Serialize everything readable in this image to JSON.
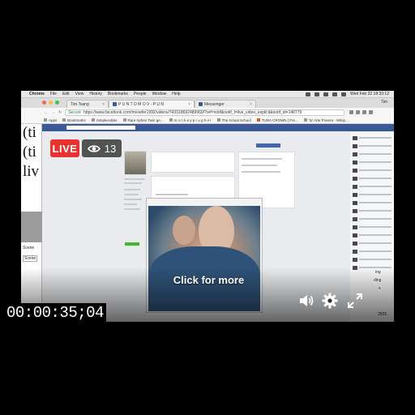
{
  "menubar": {
    "app": "Chrome",
    "items": [
      "File",
      "Edit",
      "View",
      "History",
      "Bookmarks",
      "People",
      "Window",
      "Help"
    ],
    "clock": "Wed Feb 22  18:33:12"
  },
  "browser": {
    "profile": "Tim",
    "tabs": [
      {
        "label": "Tim Tsang"
      },
      {
        "label": "P U N T O M O V - P U N"
      },
      {
        "label": "Messenger"
      }
    ],
    "secure_label": "Secure",
    "url": "https://www.facebook.com/movefer1992/videos/743318692489960/?ref=notif&notif_t=live_video_explicit&notif_id=148779",
    "bookmarks": [
      "Apps",
      "Bookmarks",
      "SimpleAdder",
      "Rare Aphex Twin ge...",
      "m o n k e y p r o g h e t",
      "The Actual School",
      "TUNA CROWN | Fre...",
      "'to' Arte Povera - Wikip..."
    ]
  },
  "page": {
    "left_strip_lines": [
      "(ti",
      "(ti",
      "liv"
    ],
    "left_strip_labels": [
      "Scene",
      "Scene"
    ],
    "right_partial_labels": [
      "ing",
      "ding",
      "s"
    ],
    "right_bottom_number": "2555"
  },
  "overlay": {
    "live_label": "LIVE",
    "viewer_count": "13",
    "cta": "Click for more",
    "timecode": "00:00:35;04"
  },
  "colors": {
    "live": "#e9312d",
    "facebook": "#3b5998"
  },
  "icons": [
    "eye-icon",
    "volume-icon",
    "settings-icon",
    "fullscreen-icon"
  ]
}
